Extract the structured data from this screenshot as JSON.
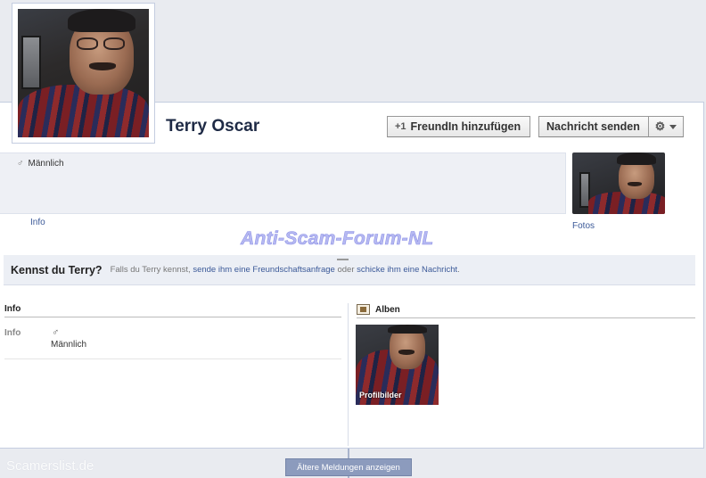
{
  "profile": {
    "name": "Terry Oscar",
    "gender": "Männlich",
    "gender_symbol": "♂"
  },
  "actions": {
    "add_friend_label": "FreundIn hinzufügen",
    "add_friend_icon": "add-friend-icon",
    "send_message_label": "Nachricht senden",
    "settings_icon": "⚙"
  },
  "links": {
    "info": "Info",
    "fotos": "Fotos"
  },
  "watermark": "Anti-Scam-Forum-NL",
  "know_bar": {
    "title": "Kennst du Terry?",
    "text_prefix": "Falls du Terry kennst,",
    "link_friend_request": "sende ihm eine Freundschaftsanfrage",
    "text_or": "oder",
    "link_message": "schicke ihm eine Nachricht",
    "text_suffix": "."
  },
  "info_section": {
    "heading": "Info",
    "row_label": "Info",
    "row_symbol": "♂",
    "row_value": "Männlich"
  },
  "albums_section": {
    "heading": "Alben",
    "album_name": "Profilbilder"
  },
  "footer": {
    "older_posts_button": "Ältere Meldungen anzeigen",
    "site_watermark": "Scamerslist.de"
  },
  "colors": {
    "link": "#3b5998",
    "name": "#1e2a45",
    "watermark": "#b6b9f2",
    "button_blue": "#8c9bbd"
  }
}
